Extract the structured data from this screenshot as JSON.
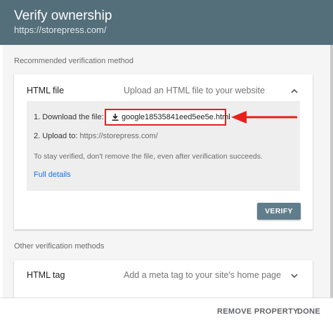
{
  "header": {
    "title": "Verify ownership",
    "subtitle": "https://storepress.com/"
  },
  "recommended": {
    "section_label": "Recommended verification method",
    "card": {
      "title": "HTML file",
      "description": "Upload an HTML file to your website",
      "steps": {
        "download_label": "1. Download the file:",
        "download_file": "google18535841eed5ee5e.html",
        "upload_label": "2. Upload to:",
        "upload_url": "https://storepress.com/"
      },
      "note": "To stay verified, don't remove the file, even after verification succeeds.",
      "details_link": "Full details",
      "verify_button": "VERIFY"
    }
  },
  "other": {
    "section_label": "Other verification methods",
    "card": {
      "title": "HTML tag",
      "description": "Add a meta tag to your site's home page"
    }
  },
  "footer": {
    "remove_property": "REMOVE PROPERTY",
    "done": "DONE"
  },
  "colors": {
    "header_bg": "#546e7a",
    "verify_bg": "#607d8b",
    "highlight": "#e8201a",
    "link": "#1a73e8"
  },
  "icons": [
    "download-icon",
    "chevron-up-icon",
    "chevron-down-icon",
    "arrow-pointer-icon"
  ]
}
